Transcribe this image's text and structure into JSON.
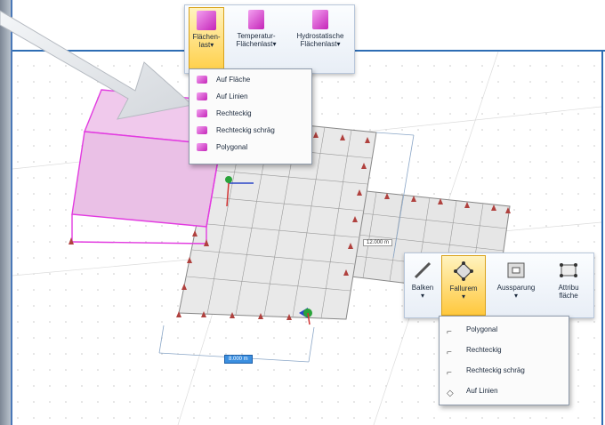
{
  "ribbon_top": {
    "buttons": [
      {
        "label": "Flächen-\nlast▾",
        "active": true
      },
      {
        "label": "Temperatur-\nFlächenlast▾",
        "active": false
      },
      {
        "label": "Hydrostatische\nFlächenlast▾",
        "active": false
      }
    ]
  },
  "load_menu": {
    "items": [
      "Auf Fläche",
      "Auf Linien",
      "Rechteckig",
      "Rechteckig schräg",
      "Polygonal"
    ]
  },
  "ribbon_bottom": {
    "buttons": [
      {
        "label": "Balken\n▾",
        "icon": "pen-icon",
        "active": false
      },
      {
        "label": "Fallurem\n▾",
        "icon": "polygon-area-icon",
        "active": true
      },
      {
        "label": "Aussparung\n▾",
        "icon": "opening-icon",
        "active": false
      },
      {
        "label": "Attribu\nfläche",
        "icon": "attribute-area-icon",
        "active": false
      }
    ]
  },
  "shape_menu": {
    "items": [
      "Polygonal",
      "Rechteckig",
      "Rechteckig schräg",
      "Auf Linien"
    ]
  },
  "dimensions": {
    "bottom": "8.000 m",
    "right": "12.000 m"
  },
  "colors": {
    "accent": "#2e6db4",
    "magenta": "#e23be0",
    "support": "#b0413e",
    "grid": "#8c8c8c"
  }
}
